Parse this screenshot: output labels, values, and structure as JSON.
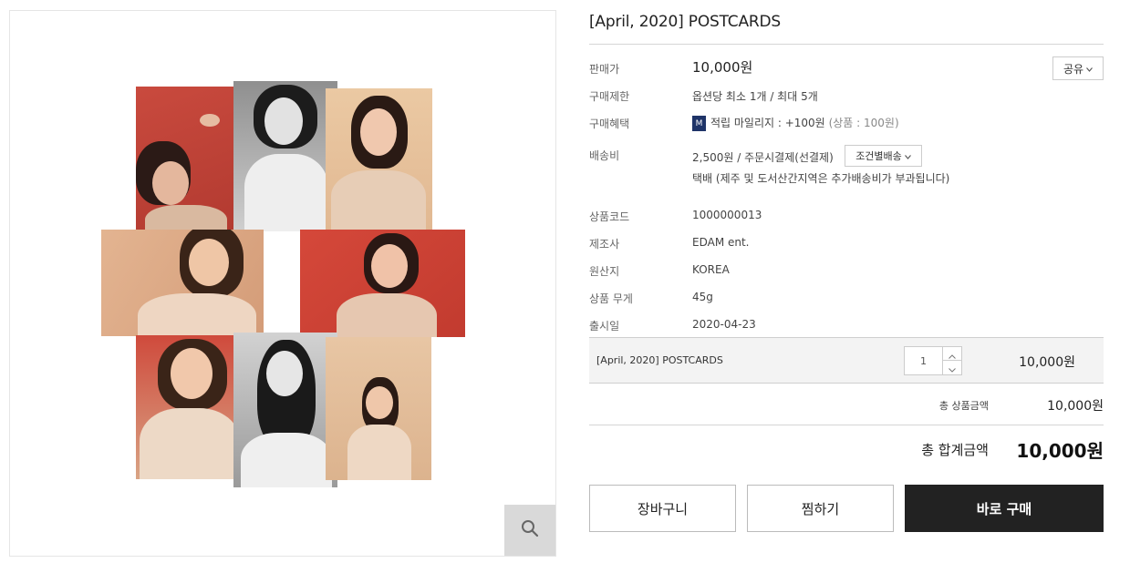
{
  "product": {
    "title": "[April, 2020] POSTCARDS"
  },
  "details": {
    "price_label": "판매가",
    "price_value": "10,000원",
    "limit_label": "구매제한",
    "limit_value": "옵션당 최소 1개 / 최대 5개",
    "benefit_label": "구매혜택",
    "benefit_badge": "M",
    "benefit_text": "적립 마일리지 : +100원",
    "benefit_note": "(상품 : 100원)",
    "shipping_label": "배송비",
    "shipping_value": "2,500원  / 주문시결제(선결제)",
    "shipping_condition_btn": "조건별배송",
    "shipping_note": "택배 (제주 및 도서산간지역은 추가배송비가 부과됩니다)",
    "code_label": "상품코드",
    "code_value": "1000000013",
    "maker_label": "제조사",
    "maker_value": "EDAM ent.",
    "origin_label": "원산지",
    "origin_value": "KOREA",
    "weight_label": "상품 무게",
    "weight_value": "45g",
    "release_label": "출시일",
    "release_value": "2020-04-23"
  },
  "share": {
    "label": "공유"
  },
  "option": {
    "name": "[April, 2020] POSTCARDS",
    "quantity": "1",
    "price": "10,000원"
  },
  "totals": {
    "subtotal_label": "총 상품금액",
    "subtotal_value": "10,000원",
    "grand_label": "총 합계금액",
    "grand_value": "10,000원"
  },
  "buttons": {
    "cart": "장바구니",
    "wish": "찜하기",
    "buy": "바로 구매"
  },
  "icons": {
    "zoom": "search-icon",
    "share_caret": "chevron-down-icon",
    "qty_up": "chevron-up-icon",
    "qty_down": "chevron-down-icon"
  },
  "colors": {
    "accent_dark": "#222222",
    "mileage_badge": "#1f3468",
    "zoom_bg": "#d9d9d9"
  }
}
